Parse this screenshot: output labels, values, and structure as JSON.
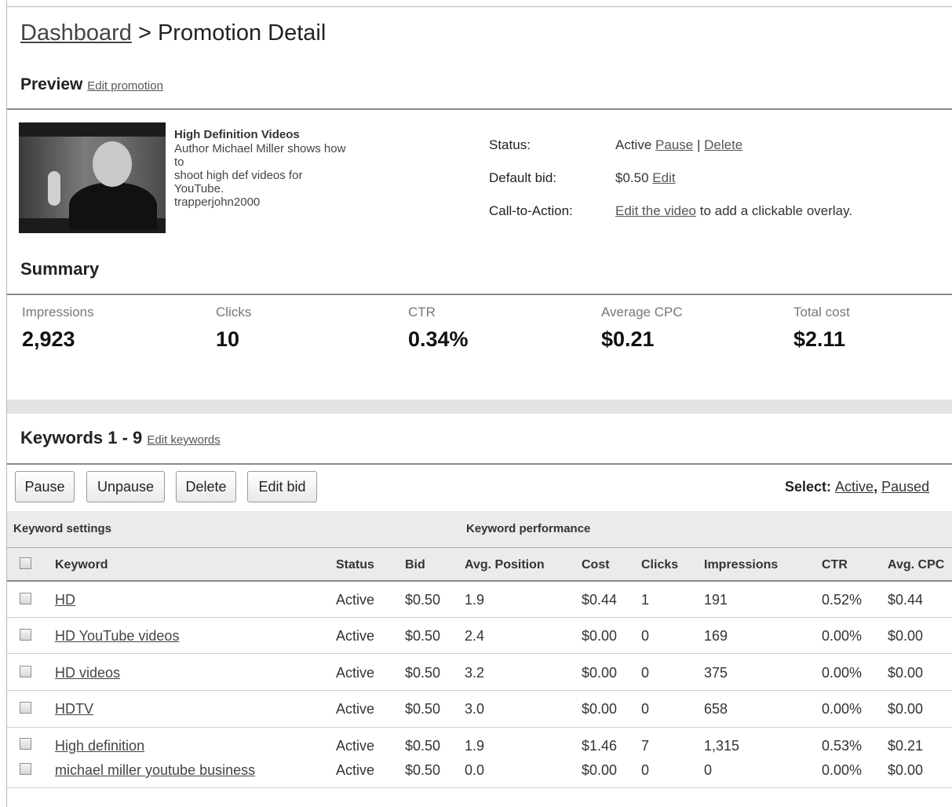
{
  "breadcrumb": {
    "parent": "Dashboard",
    "separator": ">",
    "current": "Promotion Detail"
  },
  "preview": {
    "title": "Preview",
    "edit_link": "Edit promotion"
  },
  "video": {
    "title": "High Definition Videos",
    "description": "Author Michael Miller shows how\nto\nshoot high def videos for\nYouTube.\ntrapperjohn2000",
    "thumbnail_icon": "video-thumbnail-icon"
  },
  "details": {
    "status_label": "Status:",
    "status_value": "Active",
    "pause_link": "Pause",
    "divider": "|",
    "delete_link": "Delete",
    "bid_label": "Default bid:",
    "bid_value": "$0.50",
    "bid_edit_link": "Edit",
    "cta_label": "Call-to-Action:",
    "cta_link": "Edit the video",
    "cta_text": "to add a clickable overlay."
  },
  "summary": {
    "title": "Summary",
    "metrics": [
      {
        "label": "Impressions",
        "value": "2,923"
      },
      {
        "label": "Clicks",
        "value": "10"
      },
      {
        "label": "CTR",
        "value": "0.34%"
      },
      {
        "label": "Average CPC",
        "value": "$0.21"
      },
      {
        "label": "Total cost",
        "value": "$2.11"
      }
    ]
  },
  "keywords": {
    "title": "Keywords 1 - 9",
    "edit_link": "Edit keywords",
    "buttons": {
      "pause": "Pause",
      "unpause": "Unpause",
      "delete": "Delete",
      "edit_bid": "Edit bid"
    },
    "select": {
      "label": "Select:",
      "active": "Active",
      "comma": ",",
      "paused": "Paused"
    },
    "groups": {
      "settings": "Keyword settings",
      "performance": "Keyword performance"
    },
    "columns": [
      "Keyword",
      "Status",
      "Bid",
      "Avg. Position",
      "Cost",
      "Clicks",
      "Impressions",
      "CTR",
      "Avg. CPC"
    ],
    "rows": [
      {
        "keyword": "HD",
        "status": "Active",
        "bid": "$0.50",
        "avg_position": "1.9",
        "cost": "$0.44",
        "clicks": "1",
        "impressions": "191",
        "ctr": "0.52%",
        "avg_cpc": "$0.44"
      },
      {
        "keyword": "HD YouTube videos",
        "status": "Active",
        "bid": "$0.50",
        "avg_position": "2.4",
        "cost": "$0.00",
        "clicks": "0",
        "impressions": "169",
        "ctr": "0.00%",
        "avg_cpc": "$0.00"
      },
      {
        "keyword": "HD videos",
        "status": "Active",
        "bid": "$0.50",
        "avg_position": "3.2",
        "cost": "$0.00",
        "clicks": "0",
        "impressions": "375",
        "ctr": "0.00%",
        "avg_cpc": "$0.00"
      },
      {
        "keyword": "HDTV",
        "status": "Active",
        "bid": "$0.50",
        "avg_position": "3.0",
        "cost": "$0.00",
        "clicks": "0",
        "impressions": "658",
        "ctr": "0.00%",
        "avg_cpc": "$0.00"
      },
      {
        "keyword": "High definition",
        "status": "Active",
        "bid": "$0.50",
        "avg_position": "1.9",
        "cost": "$1.46",
        "clicks": "7",
        "impressions": "1,315",
        "ctr": "0.53%",
        "avg_cpc": "$0.21"
      },
      {
        "keyword": "michael miller youtube business",
        "status": "Active",
        "bid": "$0.50",
        "avg_position": "0.0",
        "cost": "$0.00",
        "clicks": "0",
        "impressions": "0",
        "ctr": "0.00%",
        "avg_cpc": "$0.00"
      }
    ]
  }
}
